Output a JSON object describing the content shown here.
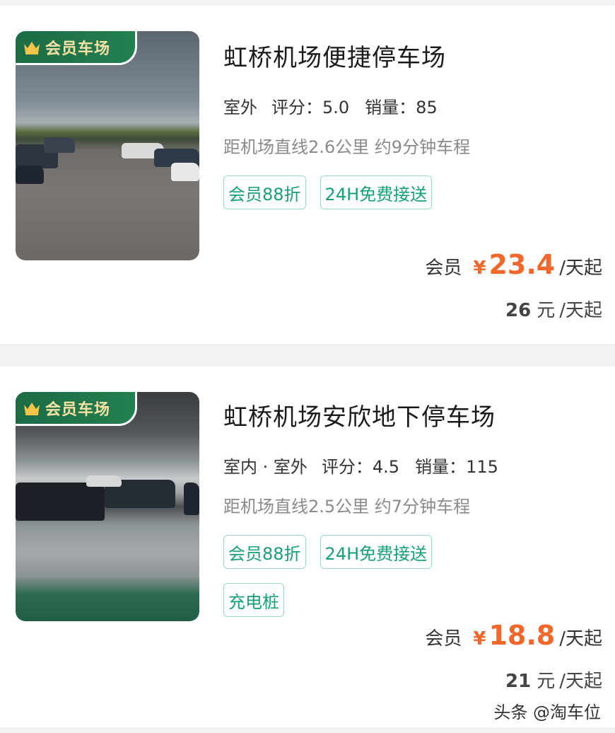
{
  "listings": [
    {
      "badge": "会员车场",
      "title": "虹桥机场便捷停车场",
      "env": "室外",
      "rating_label": "评分：",
      "rating": "5.0",
      "sales_label": "销量：",
      "sales": "85",
      "distance": "距机场直线2.6公里 约9分钟车程",
      "tags": [
        "会员88折",
        "24H免费接送"
      ],
      "member_label": "会员",
      "currency": "¥",
      "member_price": "23.4",
      "per_day": "/天起",
      "base_price": "26",
      "base_unit": "元",
      "base_per_day": "/天起"
    },
    {
      "badge": "会员车场",
      "title": "虹桥机场安欣地下停车场",
      "env": "室内 · 室外",
      "rating_label": "评分：",
      "rating": "4.5",
      "sales_label": "销量：",
      "sales": "115",
      "distance": "距机场直线2.5公里 约7分钟车程",
      "tags": [
        "会员88折",
        "24H免费接送",
        "充电桩"
      ],
      "member_label": "会员",
      "currency": "¥",
      "member_price": "18.8",
      "per_day": "/天起",
      "base_price": "21",
      "base_unit": "元",
      "base_per_day": "/天起"
    }
  ],
  "watermark": "头条 @淘车位",
  "colors": {
    "accent_green": "#16a07a",
    "price_orange": "#f2682a",
    "badge_green": "#1c6b45",
    "badge_text": "#f7e2a6"
  },
  "icons": {
    "badge_icon": "crown-icon"
  }
}
